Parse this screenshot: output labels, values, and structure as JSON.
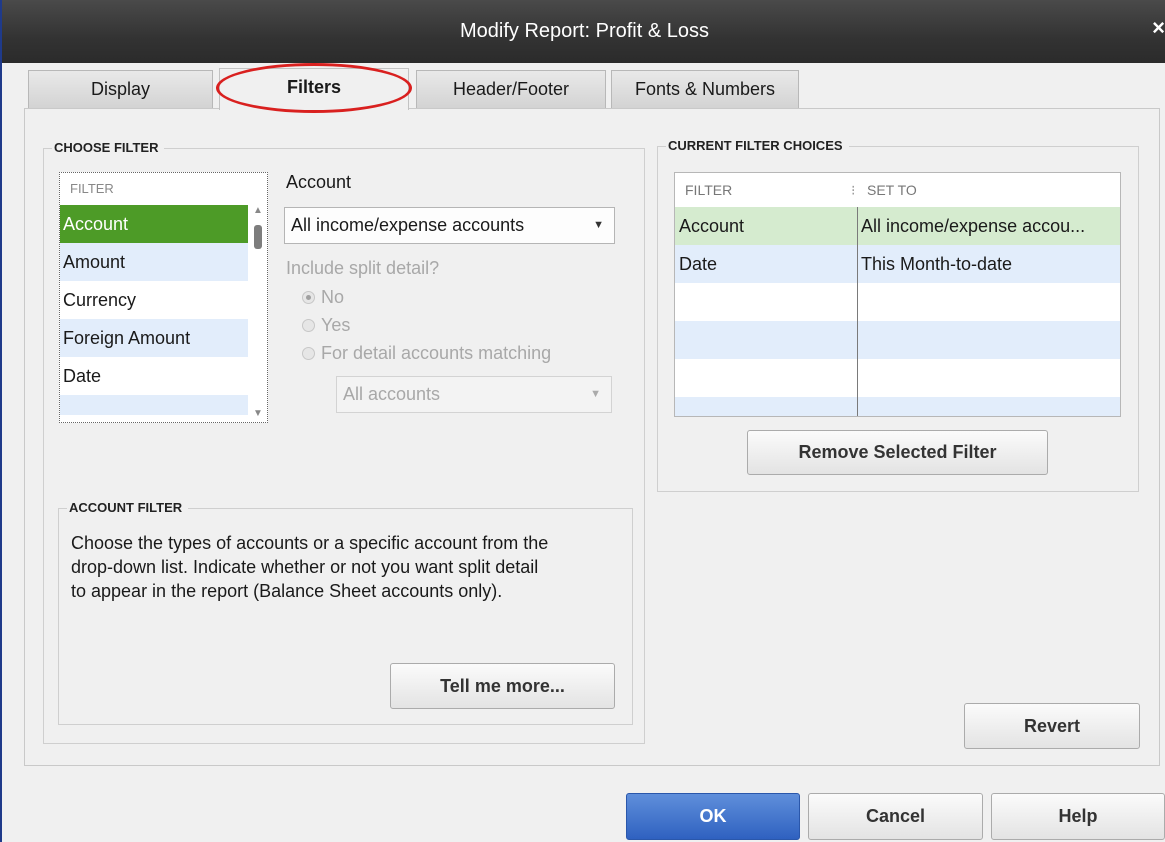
{
  "window": {
    "title": "Modify Report: Profit & Loss",
    "close_symbol": "×"
  },
  "tabs": [
    {
      "label": "Display",
      "active": false
    },
    {
      "label": "Filters",
      "active": true
    },
    {
      "label": "Header/Footer",
      "active": false
    },
    {
      "label": "Fonts & Numbers",
      "active": false
    }
  ],
  "choose_filter": {
    "title": "CHOOSE FILTER",
    "list_header": "FILTER",
    "items": [
      "Account",
      "Amount",
      "Currency",
      "Foreign Amount",
      "Date"
    ],
    "selected": "Account"
  },
  "account_options": {
    "label": "Account",
    "dropdown_value": "All income/expense accounts",
    "split_detail_label": "Include split detail?",
    "radio_no": "No",
    "radio_yes": "Yes",
    "radio_matching": "For detail accounts matching",
    "matching_dropdown_value": "All accounts"
  },
  "account_filter": {
    "title": "ACCOUNT FILTER",
    "description_line1": "Choose the types of accounts or a specific account from the",
    "description_line2": "drop-down list. Indicate whether or not you want split detail",
    "description_line3": "to appear in the report (Balance Sheet accounts only).",
    "tell_me_more": "Tell me more..."
  },
  "current_filter": {
    "title": "CURRENT FILTER CHOICES",
    "col_filter": "FILTER",
    "col_set_to": "SET TO",
    "rows": [
      {
        "filter": "Account",
        "set_to": "All income/expense accou..."
      },
      {
        "filter": "Date",
        "set_to": "This Month-to-date"
      }
    ],
    "remove_button": "Remove Selected Filter"
  },
  "buttons": {
    "revert": "Revert",
    "ok": "OK",
    "cancel": "Cancel",
    "help": "Help"
  },
  "colors": {
    "selected_row": "#4d9b27",
    "current_row": "#d5ebcf",
    "alt_row": "#e2edfb",
    "highlight_ring": "#d9201f",
    "ok_button": "#2f61c0"
  }
}
